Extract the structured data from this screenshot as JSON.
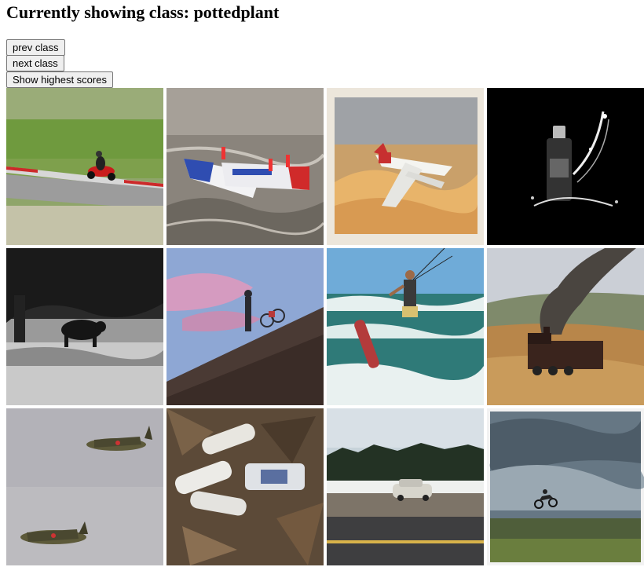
{
  "header": {
    "prefix": "Currently showing class:",
    "class_name": "pottedplant"
  },
  "buttons": {
    "prev": "prev class",
    "next": "next class",
    "highest": "Show highest scores"
  },
  "images": [
    {
      "subject": "motorcycle-racer-on-track",
      "bg": "#7f9a55"
    },
    {
      "subject": "powerboats-racing",
      "bg": "#7a756e"
    },
    {
      "subject": "airliner-photo-print",
      "bg": "#e9e2d7"
    },
    {
      "subject": "bottle-splash",
      "bg": "#000000"
    },
    {
      "subject": "bull-under-tree-bw",
      "bg": "#444444"
    },
    {
      "subject": "person-with-bicycle-on-hill",
      "bg": "#8fa8d3"
    },
    {
      "subject": "kitesurfer",
      "bg": "#6aa7d3"
    },
    {
      "subject": "steam-train",
      "bg": "#a08d70"
    },
    {
      "subject": "spitfire-planes",
      "bg": "#b9b8bd"
    },
    {
      "subject": "plastic-bottles-on-leaves",
      "bg": "#5c4a38"
    },
    {
      "subject": "car-on-road",
      "bg": "#c8d2d8"
    },
    {
      "subject": "motocross-jump",
      "bg": "#5f6f7a"
    }
  ]
}
